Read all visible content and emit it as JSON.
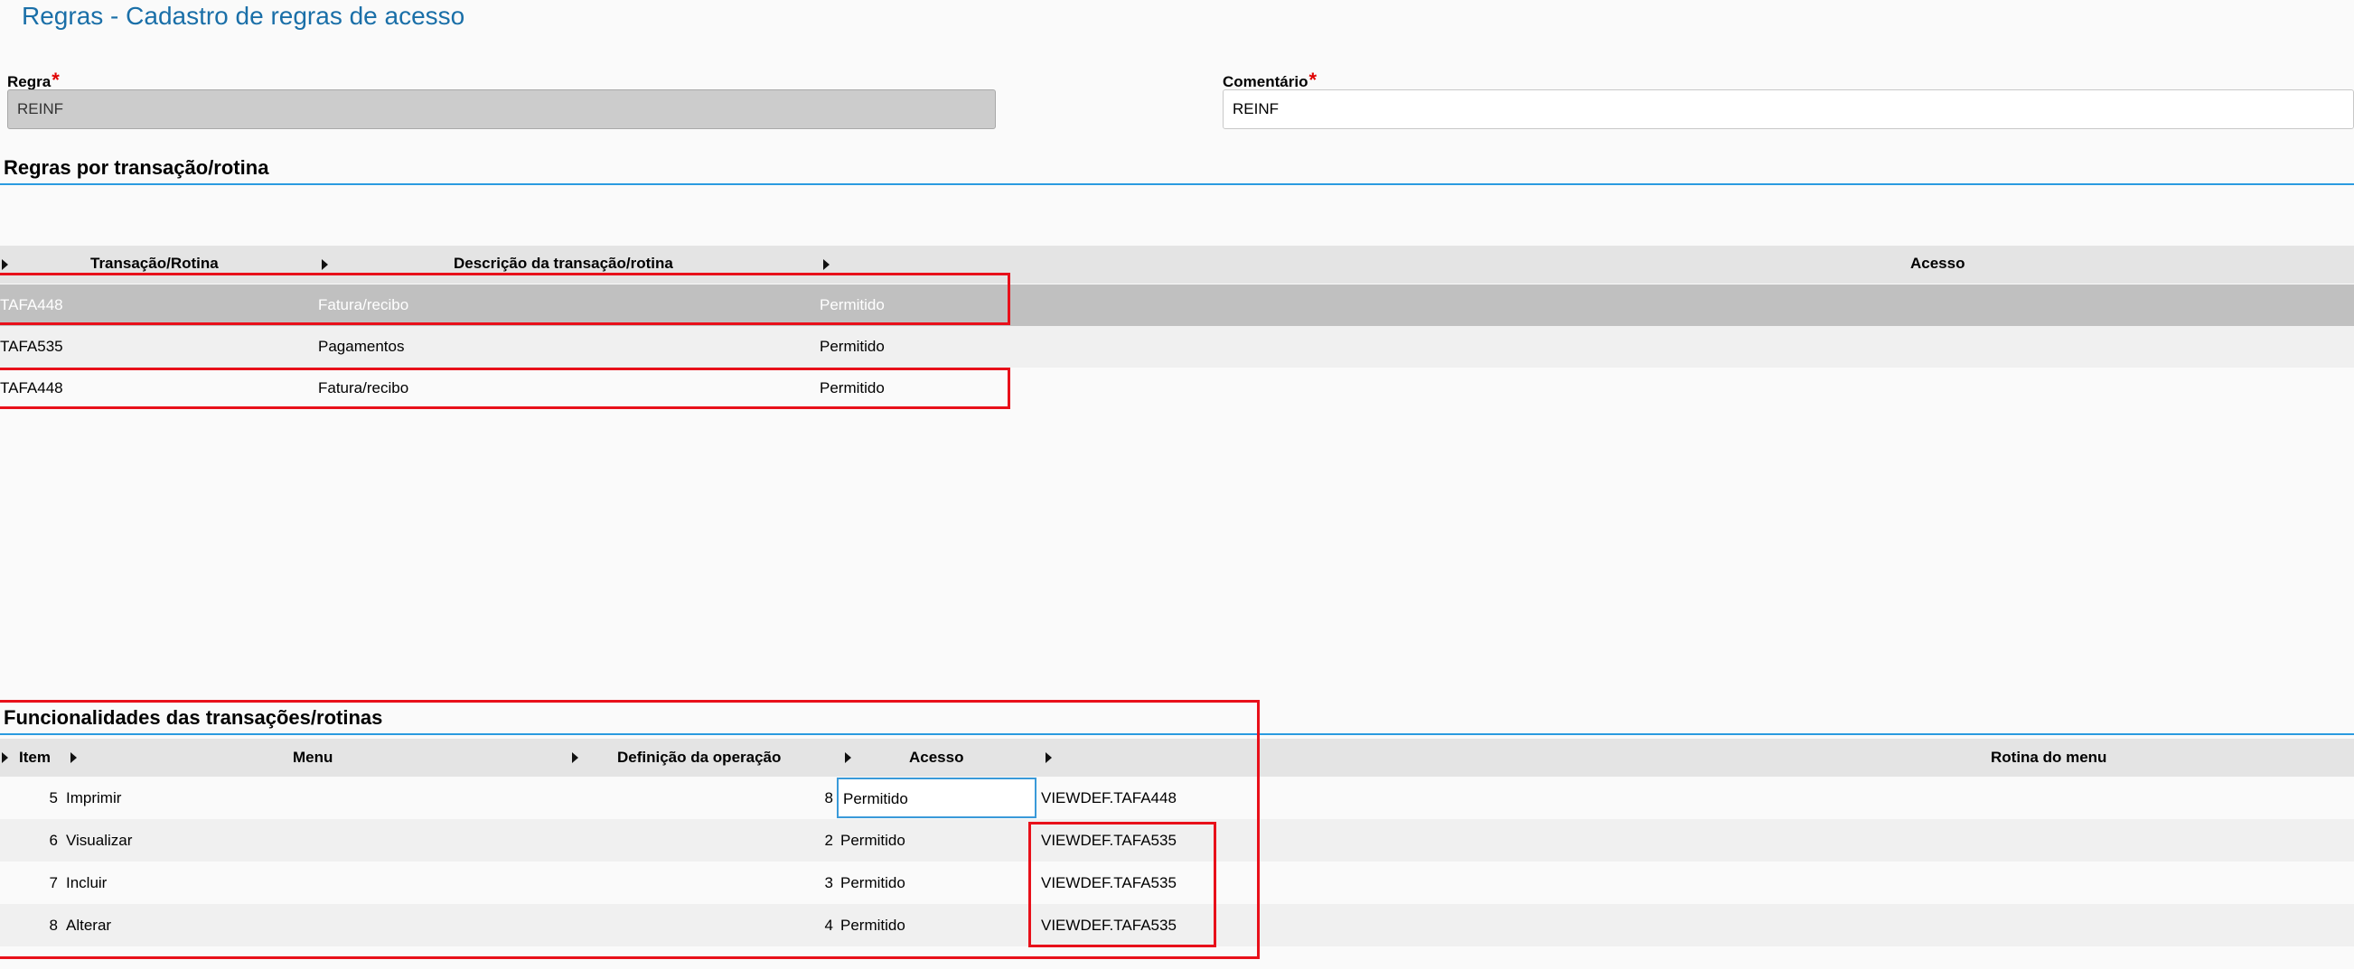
{
  "page": {
    "title": "Regras - Cadastro de regras de acesso"
  },
  "form": {
    "regra_label": "Regra",
    "regra_value": "REINF",
    "comentario_label": "Comentário",
    "comentario_value": "REINF",
    "required_mark": "*"
  },
  "rules_section": {
    "title": "Regras por transação/rotina",
    "columns": [
      "Transação/Rotina",
      "Descrição da transação/rotina",
      "Acesso"
    ],
    "rows": [
      {
        "transacao": "TAFA448",
        "descricao": "Fatura/recibo",
        "acesso": "Permitido",
        "selected": true
      },
      {
        "transacao": "TAFA535",
        "descricao": "Pagamentos",
        "acesso": "Permitido",
        "selected": false
      },
      {
        "transacao": "TAFA448",
        "descricao": "Fatura/recibo",
        "acesso": "Permitido",
        "selected": false
      }
    ]
  },
  "func_section": {
    "title": "Funcionalidades das transações/rotinas",
    "columns": [
      "Item",
      "Menu",
      "Definição da operação",
      "Acesso",
      "Rotina do menu"
    ],
    "rows": [
      {
        "item": "5",
        "menu": "Imprimir",
        "definicao": "8",
        "acesso": "Permitido",
        "rotina": "VIEWDEF.TAFA448"
      },
      {
        "item": "6",
        "menu": "Visualizar",
        "definicao": "2",
        "acesso": "Permitido",
        "rotina": "VIEWDEF.TAFA535"
      },
      {
        "item": "7",
        "menu": "Incluir",
        "definicao": "3",
        "acesso": "Permitido",
        "rotina": "VIEWDEF.TAFA535"
      },
      {
        "item": "8",
        "menu": "Alterar",
        "definicao": "4",
        "acesso": "Permitido",
        "rotina": "VIEWDEF.TAFA535"
      }
    ]
  },
  "colors": {
    "title_blue": "#1a6fa8",
    "section_line": "#2a9be0",
    "highlight_red": "#e8101a",
    "required_red": "#e00000",
    "selected_row": "#c0c0c0"
  }
}
